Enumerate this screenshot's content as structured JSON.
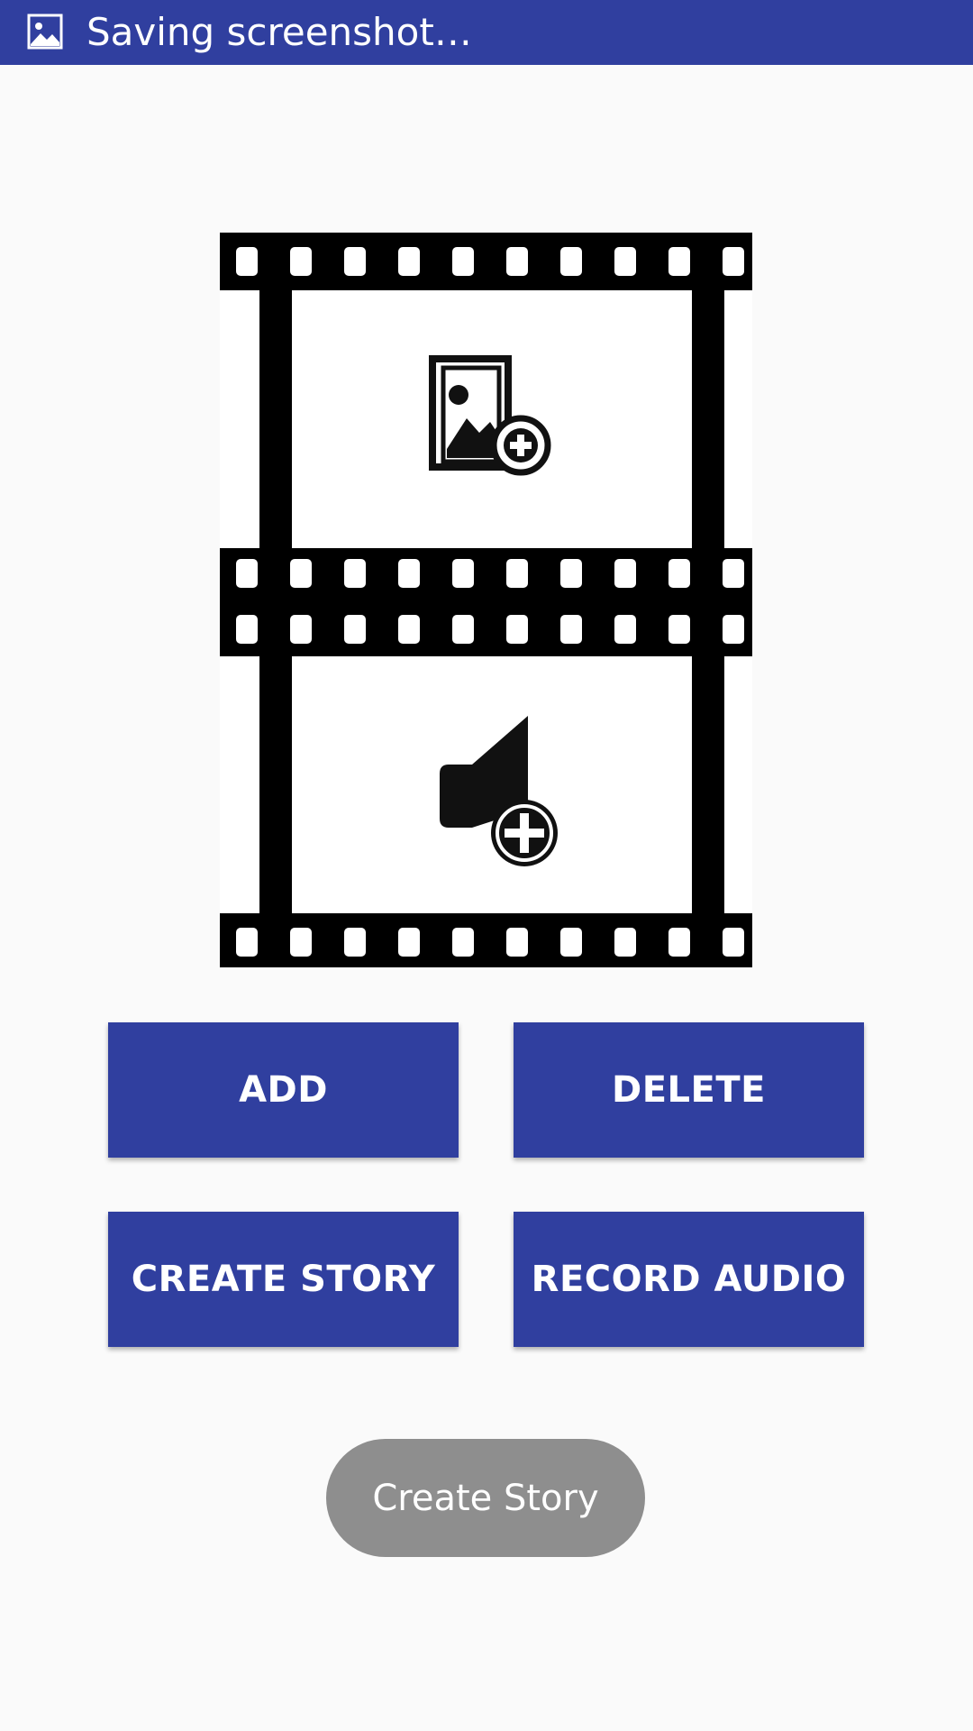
{
  "status_bar": {
    "icon": "image-icon",
    "text": "Saving screenshot…",
    "color": "#303f9f"
  },
  "story_board": {
    "top_frame_icon": "add-image-icon",
    "bottom_frame_icon": "add-audio-icon"
  },
  "buttons": {
    "add": "ADD",
    "delete": "DELETE",
    "create_story": "CREATE STORY",
    "record_audio": "RECORD AUDIO",
    "accent": "#303f9f"
  },
  "pill_button": {
    "label": "Create Story",
    "color": "#8e8e8e"
  }
}
